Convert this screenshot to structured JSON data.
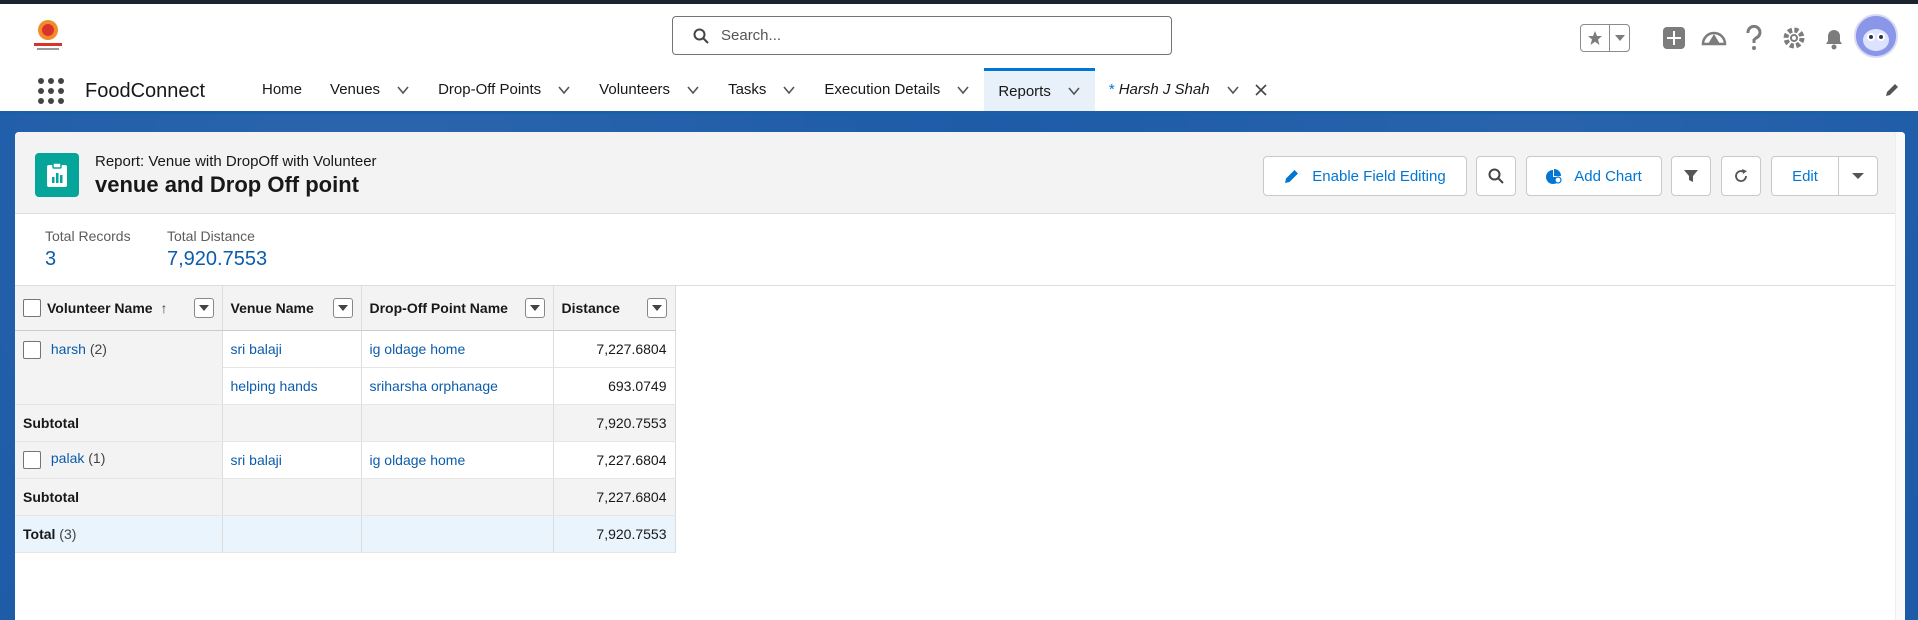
{
  "search": {
    "placeholder": "Search..."
  },
  "app": {
    "name": "FoodConnect"
  },
  "nav": {
    "items": [
      {
        "label": "Home",
        "has_chevron": false
      },
      {
        "label": "Venues",
        "has_chevron": true
      },
      {
        "label": "Drop-Off Points",
        "has_chevron": true
      },
      {
        "label": "Volunteers",
        "has_chevron": true
      },
      {
        "label": "Tasks",
        "has_chevron": true
      },
      {
        "label": "Execution Details",
        "has_chevron": true
      },
      {
        "label": "Reports",
        "has_chevron": true,
        "active": true
      }
    ],
    "record_tab": {
      "prefix": "*",
      "label": "Harsh J Shah"
    }
  },
  "report": {
    "kicker": "Report: Venue with DropOff with Volunteer",
    "title": "venue and Drop Off point",
    "buttons": {
      "enable_field_editing": "Enable Field Editing",
      "add_chart": "Add Chart",
      "edit": "Edit"
    },
    "summary": {
      "total_records_label": "Total Records",
      "total_records_value": "3",
      "total_distance_label": "Total Distance",
      "total_distance_value": "7,920.7553"
    },
    "table": {
      "headers": [
        "Volunteer Name",
        "Venue Name",
        "Drop-Off Point Name",
        "Distance"
      ],
      "sort_indicator": "↑",
      "groups": [
        {
          "name": "harsh",
          "count": "(2)",
          "rows": [
            {
              "venue": "sri balaji",
              "dropoff": "ig oldage home",
              "distance": "7,227.6804"
            },
            {
              "venue": "helping hands",
              "dropoff": "sriharsha orphanage",
              "distance": "693.0749"
            }
          ],
          "subtotal_label": "Subtotal",
          "subtotal": "7,920.7553"
        },
        {
          "name": "palak",
          "count": "(1)",
          "rows": [
            {
              "venue": "sri balaji",
              "dropoff": "ig oldage home",
              "distance": "7,227.6804"
            }
          ],
          "subtotal_label": "Subtotal",
          "subtotal": "7,227.6804"
        }
      ],
      "total_label": "Total",
      "total_count": "(3)",
      "total": "7,920.7553"
    }
  },
  "colors": {
    "brand_blue": "#0176d3",
    "nav_band": "#1d5ba8",
    "report_icon_teal": "#06a59a",
    "link": "#0b5cab"
  },
  "icons": [
    "food-connect-logo",
    "search-icon",
    "star-icon",
    "add-icon",
    "trailhead-icon",
    "help-icon",
    "gear-icon",
    "bell-icon",
    "app-launcher-icon",
    "pencil-icon",
    "filter-icon",
    "refresh-icon",
    "chart-icon"
  ]
}
